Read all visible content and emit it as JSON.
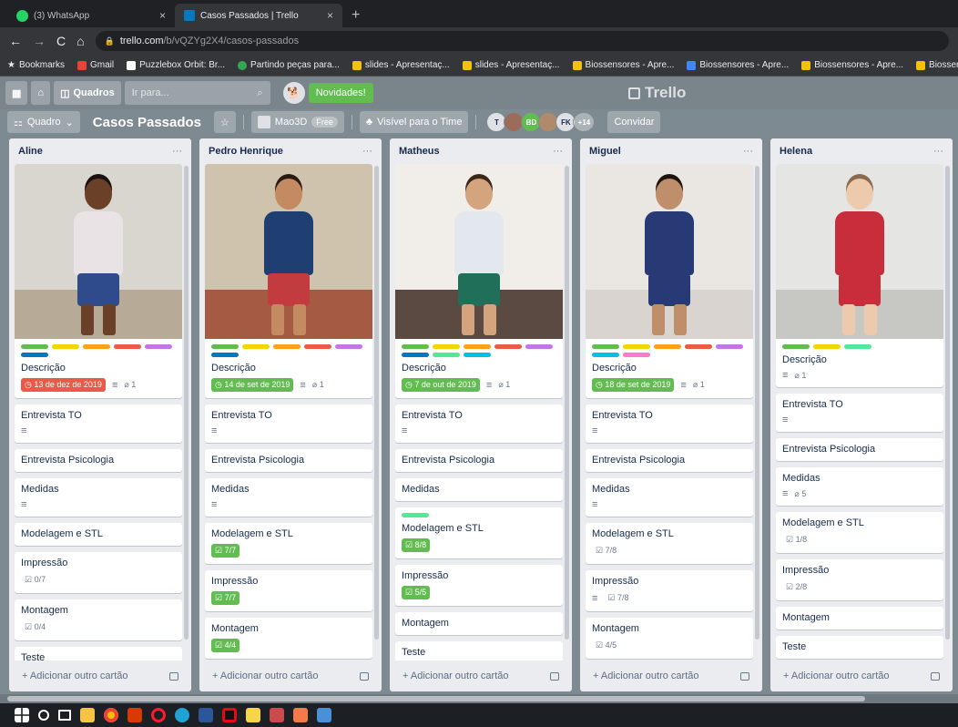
{
  "browser": {
    "tabs": [
      {
        "title": "(3) WhatsApp",
        "active": false
      },
      {
        "title": "Casos Passados | Trello",
        "active": true
      }
    ],
    "new_tab": "+",
    "url_host": "trello.com",
    "url_path": "/b/vQZYg2X4/casos-passados",
    "bookmarks_label": "Bookmarks",
    "bookmarks": [
      "Gmail",
      "Puzzlebox Orbit: Br...",
      "Partindo peças para...",
      "slides - Apresentaç...",
      "slides - Apresentaç...",
      "Biossensores - Apre...",
      "Biossensores - Apre...",
      "Biossensores - Apre...",
      "Biossensores - Apre..."
    ]
  },
  "header": {
    "boards_label": "Quadros",
    "search_placeholder": "Ir para...",
    "news_label": "Novidades!",
    "logo": "Trello"
  },
  "board": {
    "type_label": "Quadro",
    "title": "Casos Passados",
    "team_name": "Mao3D",
    "team_badge": "Free",
    "visibility": "Visível para o Time",
    "avatars": [
      "T",
      "",
      "BD",
      "",
      "FK"
    ],
    "extra_members": "+14",
    "invite": "Convidar"
  },
  "colors": {
    "green": "#61bd4f",
    "yellow": "#f2d600",
    "orange": "#ff9f1a",
    "red": "#eb5a46",
    "purple": "#c377e0",
    "blue": "#0079bf",
    "sky": "#00c2e0",
    "lime": "#51e898",
    "pink": "#ff78cb"
  },
  "add_card_label": "+ Adicionar outro cartão",
  "lists": [
    {
      "name": "Aline",
      "cards": [
        {
          "cover": true,
          "labels": [
            "green",
            "yellow",
            "orange",
            "red",
            "purple",
            "blue"
          ],
          "title": "Descrição",
          "due": "13 de dez de 2019",
          "due_color": "red",
          "desc": true,
          "attach": "1"
        },
        {
          "title": "Entrevista TO",
          "desc": true
        },
        {
          "title": "Entrevista Psicologia"
        },
        {
          "title": "Medidas",
          "desc": true
        },
        {
          "title": "Modelagem e STL"
        },
        {
          "title": "Impressão",
          "checklist": "0/7",
          "done": false
        },
        {
          "title": "Montagem",
          "checklist": "0/4",
          "done": false
        },
        {
          "title": "Teste",
          "desc": true
        }
      ]
    },
    {
      "name": "Pedro Henrique",
      "cards": [
        {
          "cover": true,
          "labels": [
            "green",
            "yellow",
            "orange",
            "red",
            "purple",
            "blue"
          ],
          "title": "Descrição",
          "due": "14 de set de 2019",
          "due_color": "green",
          "desc": true,
          "attach": "1"
        },
        {
          "title": "Entrevista TO",
          "desc": true
        },
        {
          "title": "Entrevista Psicologia"
        },
        {
          "title": "Medidas",
          "desc": true
        },
        {
          "title": "Modelagem e STL",
          "checklist": "7/7",
          "done": true
        },
        {
          "title": "Impressão",
          "checklist": "7/7",
          "done": true
        },
        {
          "title": "Montagem",
          "checklist": "4/4",
          "done": true
        }
      ]
    },
    {
      "name": "Matheus",
      "cards": [
        {
          "cover": true,
          "labels": [
            "green",
            "yellow",
            "orange",
            "red",
            "purple",
            "blue",
            "lime",
            "sky"
          ],
          "title": "Descrição",
          "due": "7 de out de 2019",
          "due_color": "green",
          "desc": true,
          "attach": "1"
        },
        {
          "title": "Entrevista TO",
          "desc": true
        },
        {
          "title": "Entrevista Psicologia"
        },
        {
          "title": "Medidas"
        },
        {
          "labels": [
            "lime"
          ],
          "title": "Modelagem e STL",
          "checklist": "8/8",
          "done": true
        },
        {
          "title": "Impressão",
          "checklist": "5/5",
          "done": true
        },
        {
          "title": "Montagem"
        },
        {
          "title": "Teste"
        }
      ]
    },
    {
      "name": "Miguel",
      "cards": [
        {
          "cover": true,
          "labels": [
            "green",
            "yellow",
            "orange",
            "red",
            "purple",
            "sky",
            "pink"
          ],
          "title": "Descrição",
          "due": "18 de set de 2019",
          "due_color": "green",
          "desc": true,
          "attach": "1"
        },
        {
          "title": "Entrevista TO",
          "desc": true
        },
        {
          "title": "Entrevista Psicologia"
        },
        {
          "title": "Medidas",
          "desc": true
        },
        {
          "title": "Modelagem e STL",
          "checklist": "7/8",
          "done": false
        },
        {
          "title": "Impressão",
          "desc": true,
          "checklist": "7/8",
          "done": false
        },
        {
          "title": "Montagem",
          "checklist": "4/5",
          "done": false
        }
      ]
    },
    {
      "name": "Helena",
      "cards": [
        {
          "cover": true,
          "labels": [
            "green",
            "yellow",
            "lime"
          ],
          "title": "Descrição",
          "desc": true,
          "attach": "1"
        },
        {
          "title": "Entrevista TO",
          "desc": true
        },
        {
          "title": "Entrevista Psicologia"
        },
        {
          "title": "Medidas",
          "desc": true,
          "attach": "5"
        },
        {
          "title": "Modelagem e STL",
          "checklist": "1/8",
          "done": false
        },
        {
          "title": "Impressão",
          "checklist": "2/8",
          "done": false
        },
        {
          "title": "Montagem"
        },
        {
          "title": "Teste"
        }
      ]
    }
  ]
}
